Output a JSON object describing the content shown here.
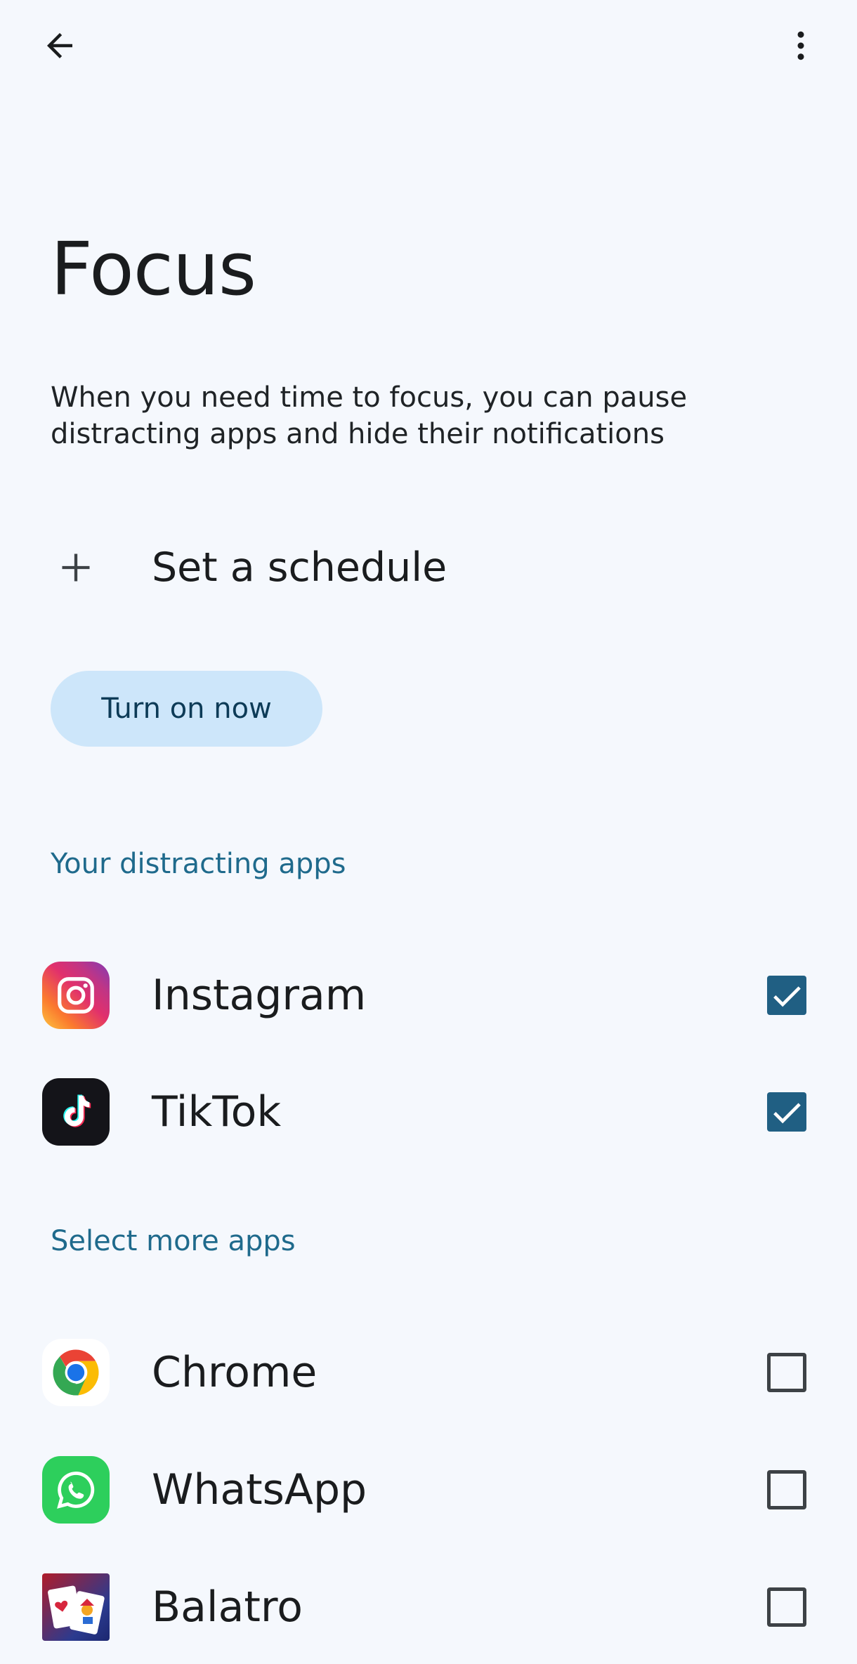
{
  "header": {
    "back_icon": "arrow-left-icon",
    "menu_icon": "more-vert-icon"
  },
  "page": {
    "title": "Focus",
    "description": "When you need time to focus, you can pause distracting apps and hide their notifications"
  },
  "schedule": {
    "icon": "plus-icon",
    "label": "Set a schedule"
  },
  "turn_on_button": {
    "label": "Turn on now"
  },
  "distracting_section": {
    "header": "Your distracting apps",
    "apps": [
      {
        "name": "Instagram",
        "icon": "instagram-icon",
        "checked": true
      },
      {
        "name": "TikTok",
        "icon": "tiktok-icon",
        "checked": true
      }
    ]
  },
  "more_section": {
    "header": "Select more apps",
    "apps": [
      {
        "name": "Chrome",
        "icon": "chrome-icon",
        "checked": false
      },
      {
        "name": "WhatsApp",
        "icon": "whatsapp-icon",
        "checked": false
      },
      {
        "name": "Balatro",
        "icon": "balatro-icon",
        "checked": false
      }
    ]
  },
  "colors": {
    "background": "#f5f8fd",
    "accent": "#205f83",
    "section_header": "#1f6a8c",
    "button_bg": "#cde6fa",
    "button_text": "#0d3b57"
  }
}
